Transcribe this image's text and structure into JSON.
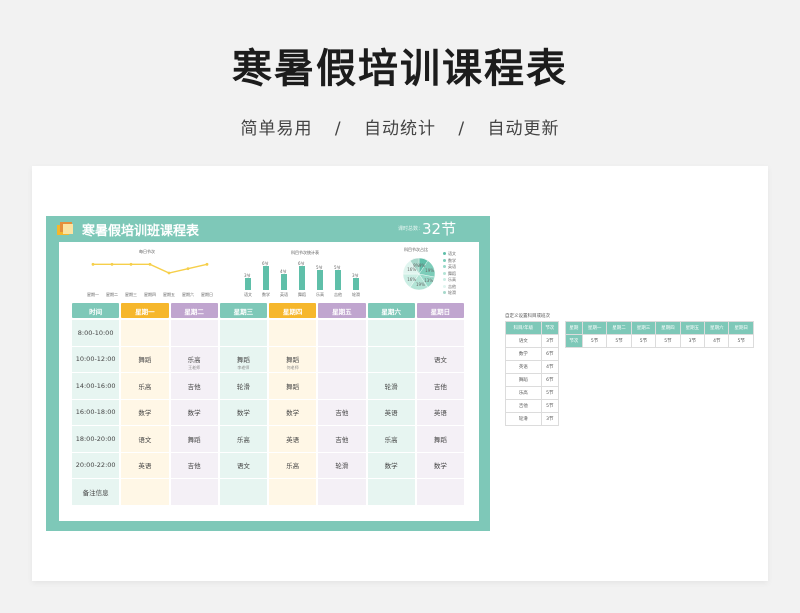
{
  "hero": {
    "title": "寒暑假培训课程表",
    "subtitle_items": [
      "简单易用",
      "/",
      "自动统计",
      "/",
      "自动更新"
    ]
  },
  "sheet": {
    "title": "寒暑假培训班课程表",
    "total_label": "课时总数：",
    "total_value": "32节"
  },
  "charts": {
    "line": {
      "title": "每日节次",
      "categories": [
        "星期一",
        "星期二",
        "星期三",
        "星期四",
        "星期五",
        "星期六",
        "星期日"
      ],
      "values": [
        5,
        5,
        5,
        5,
        3,
        4,
        5
      ]
    },
    "bar": {
      "title": "科目节次统计表",
      "categories": [
        "语文",
        "数学",
        "英语",
        "舞蹈",
        "乐高",
        "吉他",
        "轮滑"
      ],
      "values": [
        3,
        6,
        4,
        6,
        5,
        5,
        3
      ],
      "value_labels": [
        "3节",
        "6节",
        "4节",
        "6节",
        "5节",
        "5节",
        "3节"
      ],
      "color": "#5fbfa9"
    },
    "pie": {
      "title": "科目节次占比",
      "categories": [
        "语文",
        "数学",
        "英语",
        "舞蹈",
        "乐高",
        "吉他",
        "轮滑"
      ],
      "values": [
        3,
        6,
        4,
        6,
        5,
        5,
        3
      ],
      "slice_labels": [
        "9%",
        "19%",
        "13%",
        "19%",
        "16%",
        "16%",
        "9%"
      ],
      "colors": [
        "#5fbfa9",
        "#7ccdb9",
        "#98d9c8",
        "#b3e4d6",
        "#cbeee4",
        "#e0f5ef",
        "#a7d8cb"
      ]
    }
  },
  "schedule": {
    "headers": [
      "时间",
      "星期一",
      "星期二",
      "星期三",
      "星期四",
      "星期五",
      "星期六",
      "星期日"
    ],
    "header_colors": [
      "#7ec8b8",
      "#f6b72c",
      "#c0a5cf",
      "#7ec8b8",
      "#f6b72c",
      "#c0a5cf",
      "#7ec8b8",
      "#c0a5cf"
    ],
    "column_bg": [
      "#e7f5f1",
      "#fff7e6",
      "#f4f0f6",
      "#e7f5f1",
      "#fff7e6",
      "#f4f0f6",
      "#e7f5f1",
      "#f4f0f6"
    ],
    "rows": [
      {
        "time": "8:00-10:00",
        "cells": [
          "",
          "",
          "",
          "",
          "",
          "",
          ""
        ],
        "teachers": [
          "",
          "",
          "",
          "",
          "",
          "",
          ""
        ]
      },
      {
        "time": "10:00-12:00",
        "cells": [
          "舞蹈",
          "乐高",
          "舞蹈",
          "舞蹈",
          "",
          "",
          "语文"
        ],
        "teachers": [
          "",
          "王老师",
          "李老师",
          "何老师",
          "",
          "",
          ""
        ]
      },
      {
        "time": "14:00-16:00",
        "cells": [
          "乐高",
          "吉他",
          "轮滑",
          "舞蹈",
          "",
          "轮滑",
          "吉他"
        ],
        "teachers": [
          "",
          "",
          "",
          "",
          "",
          "",
          ""
        ]
      },
      {
        "time": "16:00-18:00",
        "cells": [
          "数学",
          "数学",
          "数学",
          "数学",
          "吉他",
          "英语",
          "英语"
        ],
        "teachers": [
          "",
          "",
          "",
          "",
          "",
          "",
          ""
        ]
      },
      {
        "time": "18:00-20:00",
        "cells": [
          "语文",
          "舞蹈",
          "乐高",
          "英语",
          "吉他",
          "乐高",
          "舞蹈"
        ],
        "teachers": [
          "",
          "",
          "",
          "",
          "",
          "",
          ""
        ]
      },
      {
        "time": "20:00-22:00",
        "cells": [
          "英语",
          "吉他",
          "语文",
          "乐高",
          "轮滑",
          "数学",
          "数学"
        ],
        "teachers": [
          "",
          "",
          "",
          "",
          "",
          "",
          ""
        ]
      },
      {
        "time": "备注信息",
        "cells": [
          "",
          "",
          "",
          "",
          "",
          "",
          ""
        ],
        "teachers": [
          "",
          "",
          "",
          "",
          "",
          "",
          ""
        ]
      }
    ]
  },
  "side": {
    "title": "自定义设置科目或班次",
    "subject_table": {
      "headers": [
        "科目/年级",
        "节次"
      ],
      "rows": [
        [
          "语文",
          "3节"
        ],
        [
          "数学",
          "6节"
        ],
        [
          "英语",
          "4节"
        ],
        [
          "舞蹈",
          "6节"
        ],
        [
          "乐高",
          "5节"
        ],
        [
          "吉他",
          "5节"
        ],
        [
          "轮滑",
          "3节"
        ]
      ]
    },
    "day_table": {
      "headers": [
        "星期",
        "星期一",
        "星期二",
        "星期三",
        "星期四",
        "星期五",
        "星期六",
        "星期日"
      ],
      "row": [
        "节次",
        "5节",
        "5节",
        "5节",
        "5节",
        "3节",
        "4节",
        "5节"
      ]
    }
  }
}
